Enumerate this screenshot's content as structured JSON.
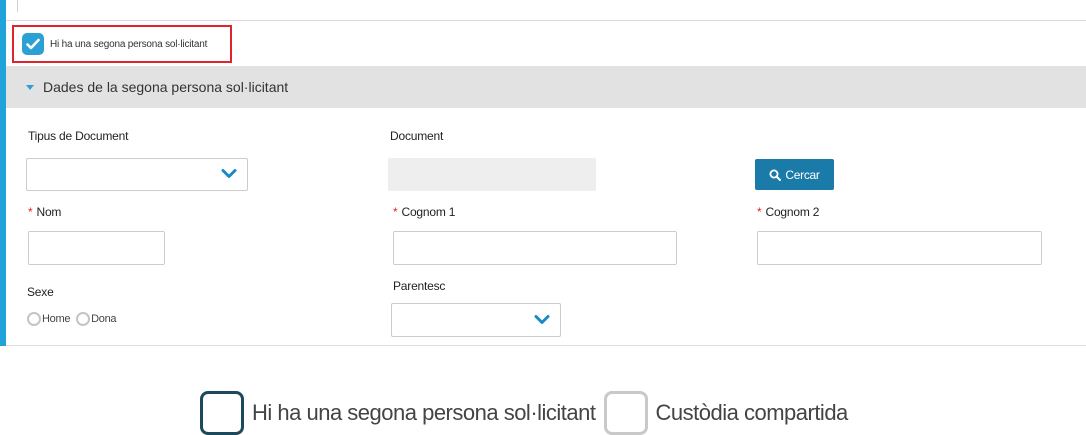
{
  "top_checkbox": {
    "label": "Hi ha una segona persona sol·licitant",
    "checked": true,
    "highlight_color": "#e0242a"
  },
  "section": {
    "title": "Dades de la segona persona sol·licitant"
  },
  "form": {
    "tipus_document": {
      "label": "Tipus de Document",
      "value": ""
    },
    "document": {
      "label": "Document",
      "value": ""
    },
    "search_button": {
      "label": "Cercar"
    },
    "nom": {
      "label": "Nom",
      "required": true,
      "value": ""
    },
    "cognom1": {
      "label": "Cognom 1",
      "required": true,
      "value": ""
    },
    "cognom2": {
      "label": "Cognom 2",
      "required": true,
      "value": ""
    },
    "sexe": {
      "label": "Sexe",
      "options": [
        "Home",
        "Dona"
      ]
    },
    "parentesc": {
      "label": "Parentesc",
      "value": ""
    }
  },
  "required_marker": "*",
  "bottom_options": [
    {
      "label": "Hi ha una segona persona sol·licitant",
      "checked": false
    },
    {
      "label": "Custòdia compartida",
      "checked": false
    }
  ],
  "colors": {
    "accent": "#1fa3d9",
    "checkbox_checked": "#2aa0d4",
    "button": "#1a7ba8",
    "required": "#e0242a"
  }
}
